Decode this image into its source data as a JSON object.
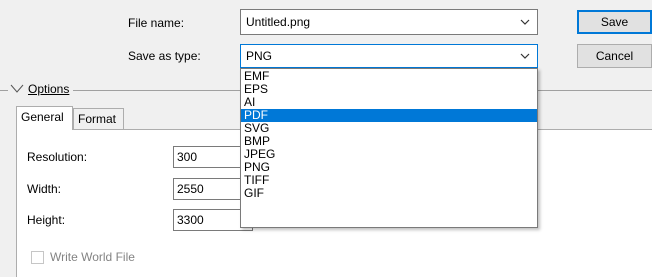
{
  "file_name": {
    "label": "File name:",
    "value": "Untitled.png"
  },
  "save_as_type": {
    "label": "Save as type:",
    "value": "PNG"
  },
  "buttons": {
    "save": "Save",
    "cancel": "Cancel"
  },
  "options": {
    "label": "Options"
  },
  "tabs": [
    {
      "label": "General",
      "active": true
    },
    {
      "label": "Format",
      "active": false
    }
  ],
  "fields": {
    "resolution": {
      "label": "Resolution:",
      "value": "300"
    },
    "width": {
      "label": "Width:",
      "value": "2550"
    },
    "height": {
      "label": "Height:",
      "value": "3300"
    }
  },
  "write_world_file": {
    "label": "Write World File",
    "checked": false,
    "enabled": false
  },
  "type_options": [
    "EMF",
    "EPS",
    "AI",
    "PDF",
    "SVG",
    "BMP",
    "JPEG",
    "PNG",
    "TIFF",
    "GIF"
  ],
  "highlighted_option": "PDF",
  "colors": {
    "accent": "#0078d7",
    "window_bg": "#f0f0f0",
    "panel_bg": "#ffffff",
    "disabled_text": "#838383"
  }
}
